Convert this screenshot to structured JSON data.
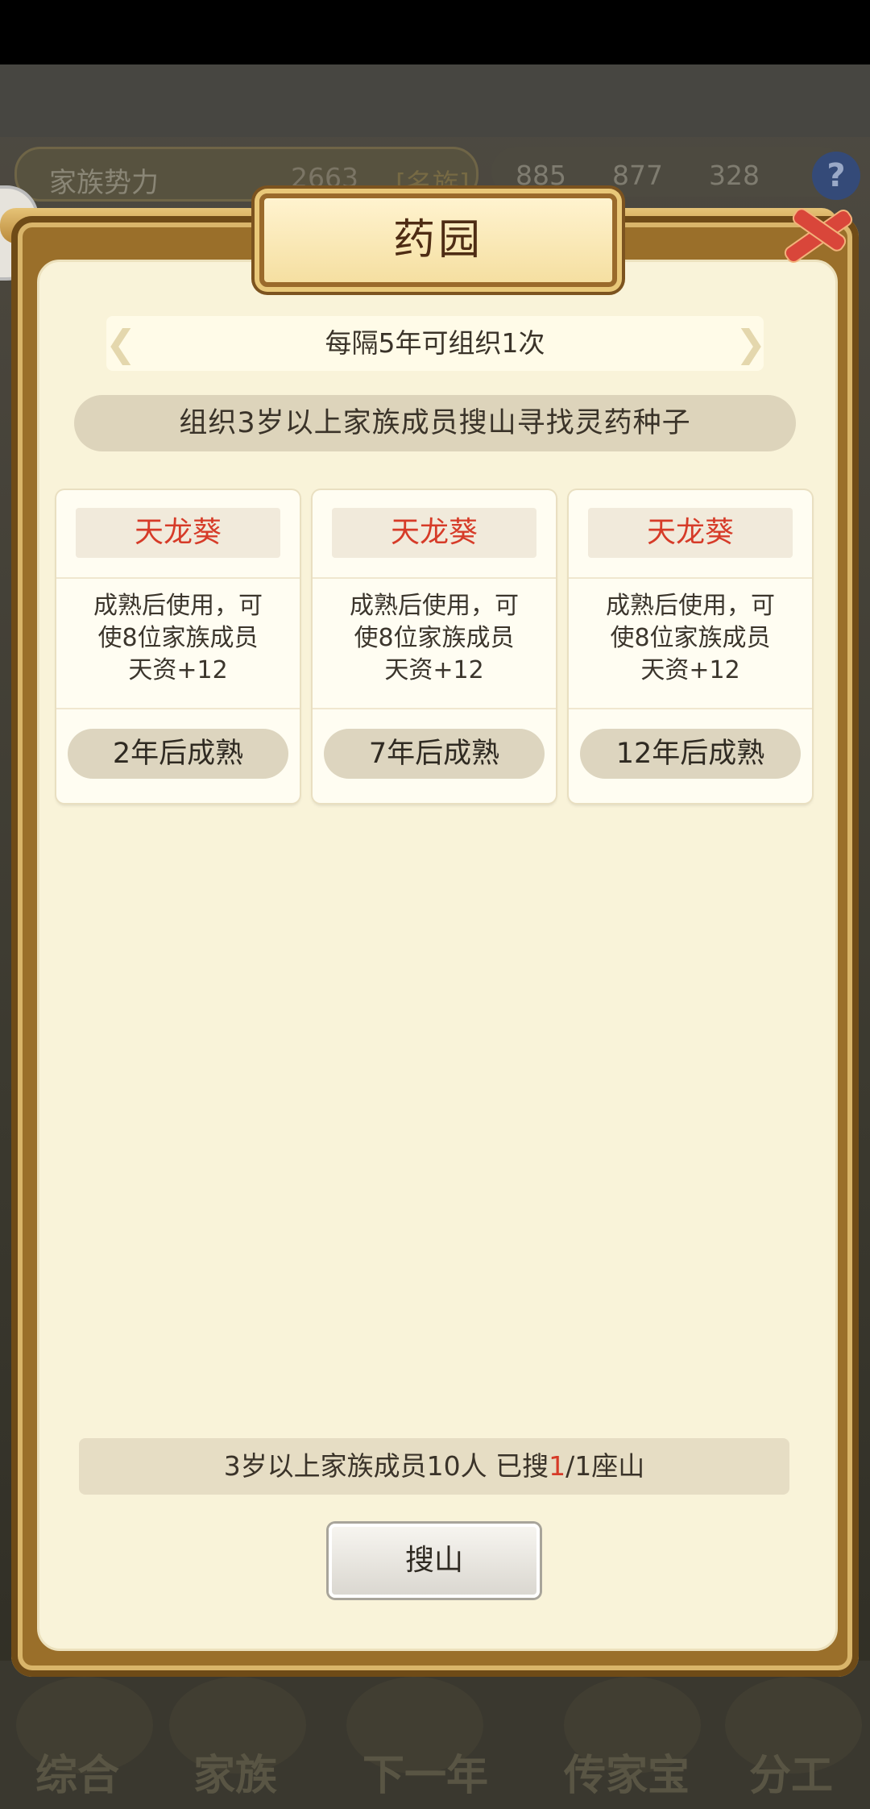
{
  "game_header": {
    "power_label": "家族势力",
    "power_value": "2663",
    "power_tag": "[名族]",
    "resource_1": "885",
    "resource_2": "877",
    "resource_3": "328"
  },
  "dialog": {
    "title": "药园",
    "interval_text": "每隔5年可组织1次",
    "description": "组织3岁以上家族成员搜山寻找灵药种子",
    "cards": [
      {
        "name": "天龙葵",
        "desc_line1": "成熟后使用，可",
        "desc_line2": "使8位家族成员",
        "desc_line3": "天资+12",
        "mature": "2年后成熟"
      },
      {
        "name": "天龙葵",
        "desc_line1": "成熟后使用，可",
        "desc_line2": "使8位家族成员",
        "desc_line3": "天资+12",
        "mature": "7年后成熟"
      },
      {
        "name": "天龙葵",
        "desc_line1": "成熟后使用，可",
        "desc_line2": "使8位家族成员",
        "desc_line3": "天资+12",
        "mature": "12年后成熟"
      }
    ],
    "status_prefix": "3岁以上家族成员10人 已搜",
    "status_current": "1",
    "status_suffix": "/1座山",
    "search_button": "搜山"
  },
  "bottom_nav": {
    "items": [
      "综合",
      "家族",
      "下一年",
      "传家宝",
      "分工"
    ]
  }
}
